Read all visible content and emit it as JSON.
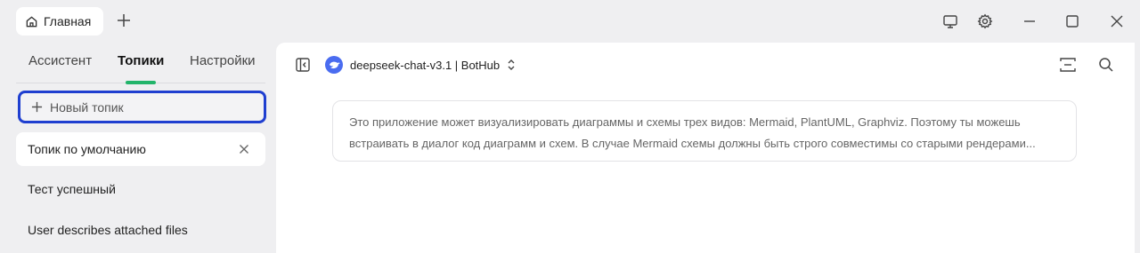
{
  "titlebar": {
    "tab_label": "Главная",
    "icons": [
      "home-icon",
      "plus-icon",
      "monitor-icon",
      "gear-icon",
      "minimize-icon",
      "maximize-icon",
      "close-icon"
    ]
  },
  "sidebar": {
    "tabs": [
      {
        "label": "Ассистент"
      },
      {
        "label": "Топики",
        "active": true
      },
      {
        "label": "Настройки"
      }
    ],
    "new_topic_label": "Новый топик",
    "topics": [
      {
        "label": "Топик по умолчанию",
        "active": true
      },
      {
        "label": "Тест успешный"
      },
      {
        "label": "User describes attached files"
      }
    ]
  },
  "main": {
    "model_label": "deepseek-chat-v3.1 | BotHub",
    "prompt_lines": [
      "Это приложение может визуализировать диаграммы и схемы трех видов: Mermaid, PlantUML, Graphviz. Поэтому ты можешь",
      "встраивать в диалог код диаграмм и схем. В случае Mermaid схемы должны быть строго совместимы со старыми рендерами..."
    ]
  },
  "colors": {
    "accent_green": "#22b46a",
    "focus_blue": "#1f3fd0",
    "model_logo": "#4a6cf0"
  }
}
